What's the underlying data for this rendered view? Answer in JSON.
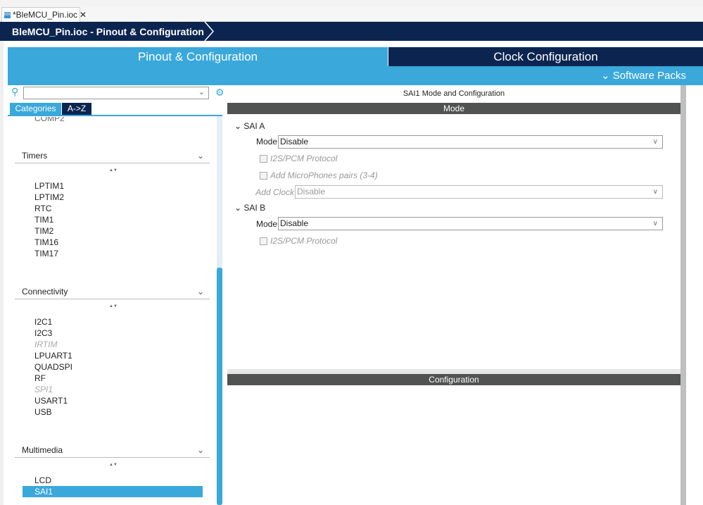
{
  "file_tab": {
    "label": "*BleMCU_Pin.ioc",
    "icon": "mx-icon"
  },
  "title": "BleMCU_Pin.ioc - Pinout & Configuration",
  "tabs": {
    "pinout": "Pinout & Configuration",
    "clock": "Clock Configuration"
  },
  "software_packs": "Software Packs",
  "left": {
    "search": {
      "value": "",
      "placeholder": ""
    },
    "tabs": {
      "categories": "Categories",
      "az": "A->Z"
    },
    "partial_item": "COMP2",
    "groups": [
      {
        "label": "Timers",
        "items": [
          {
            "label": "LPTIM1"
          },
          {
            "label": "LPTIM2"
          },
          {
            "label": "RTC"
          },
          {
            "label": "TIM1"
          },
          {
            "label": "TIM2"
          },
          {
            "label": "TIM16"
          },
          {
            "label": "TIM17"
          }
        ]
      },
      {
        "label": "Connectivity",
        "items": [
          {
            "label": "I2C1"
          },
          {
            "label": "I2C3"
          },
          {
            "label": "IRTIM",
            "disabled": true
          },
          {
            "label": "LPUART1"
          },
          {
            "label": "QUADSPI"
          },
          {
            "label": "RF"
          },
          {
            "label": "SPI1",
            "disabled": true
          },
          {
            "label": "USART1"
          },
          {
            "label": "USB"
          }
        ]
      },
      {
        "label": "Multimedia",
        "items": [
          {
            "label": "LCD"
          },
          {
            "label": "SAI1",
            "selected": true
          }
        ]
      }
    ]
  },
  "right": {
    "title": "SAI1 Mode and Configuration",
    "mode_header": "Mode",
    "config_header": "Configuration",
    "sai_a": {
      "label": "SAI A",
      "mode_label": "Mode",
      "mode_value": "Disable",
      "i2s": "I2S/PCM Protocol",
      "mics": "Add MicroPhones pairs (3-4)",
      "clock_label": "Add Clock",
      "clock_value": "Disable"
    },
    "sai_b": {
      "label": "SAI B",
      "mode_label": "Mode",
      "mode_value": "Disable",
      "i2s": "I2S/PCM Protocol"
    }
  },
  "colors": {
    "navy": "#0c2550",
    "blue": "#3aa8db",
    "header_gray": "#505352"
  }
}
